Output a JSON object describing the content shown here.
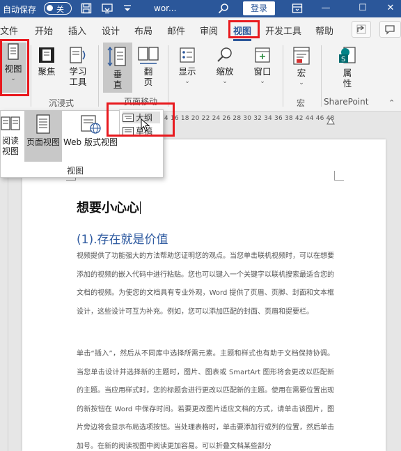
{
  "titlebar": {
    "autosave_label": "自动保存",
    "toggle_state": "关",
    "doc_name": "wor...",
    "login": "登录",
    "colors": {
      "bar": "#2b579a"
    }
  },
  "tabs": [
    "文件",
    "开始",
    "插入",
    "设计",
    "布局",
    "邮件",
    "审阅",
    "视图",
    "开发工具",
    "帮助"
  ],
  "ribbon": {
    "view_button": "视图",
    "immersive": {
      "focus": "聚焦",
      "learning_tools_line1": "学习",
      "learning_tools_line2": "工具",
      "group": "沉浸式"
    },
    "page_movement": {
      "vertical": "垂直",
      "flip": "翻页",
      "group": "页面移动"
    },
    "show": "显示",
    "zoom": "缩放",
    "window": "窗口",
    "macros": {
      "button": "宏",
      "group": "宏"
    },
    "sharepoint": {
      "button": "属性",
      "group": "SharePoint"
    }
  },
  "dropdown": {
    "read_mode_line1": "阅读",
    "read_mode_line2": "视图",
    "print_layout": "页面视图",
    "web_layout": "Web 版式视图",
    "group_label": "视图"
  },
  "submenu": {
    "outline": "大纲",
    "draft": "草稿"
  },
  "ruler_numbers": "14   16   18   20   22   24   26   28   30   32   34   36   38        42   44   46   48",
  "document": {
    "title": "想要小心心",
    "heading": "(1).存在就是价值",
    "paragraph1": "视频提供了功能强大的方法帮助您证明您的观点。当您单击联机视频时，可以在想要添加的视频的嵌入代码中进行粘贴。您也可以键入一个关键字以联机搜索最适合您的文档的视频。为使您的文档具有专业外观，Word 提供了页眉、页脚、封面和文本框设计，这些设计可互为补充。例如，您可以添加匹配的封面、页眉和提要栏。",
    "paragraph2": "单击“插入”，然后从不同库中选择所需元素。主题和样式也有助于文档保持协调。当您单击设计并选择新的主题时，图片、图表或 SmartArt 图形将会更改以匹配新的主题。当应用样式时，您的标题会进行更改以匹配新的主题。使用在需要位置出现的新按钮在 Word 中保存时间。若要更改图片适应文档的方式，请单击该图片，图片旁边将会显示布局选项按钮。当处理表格时，单击要添加行或列的位置，然后单击加号。在新的阅读视图中阅读更加容易。可以折叠文档某些部分"
  },
  "colors": {
    "accent": "#2b579a",
    "highlight": "#e8191e",
    "heading": "#2e5aa0"
  }
}
